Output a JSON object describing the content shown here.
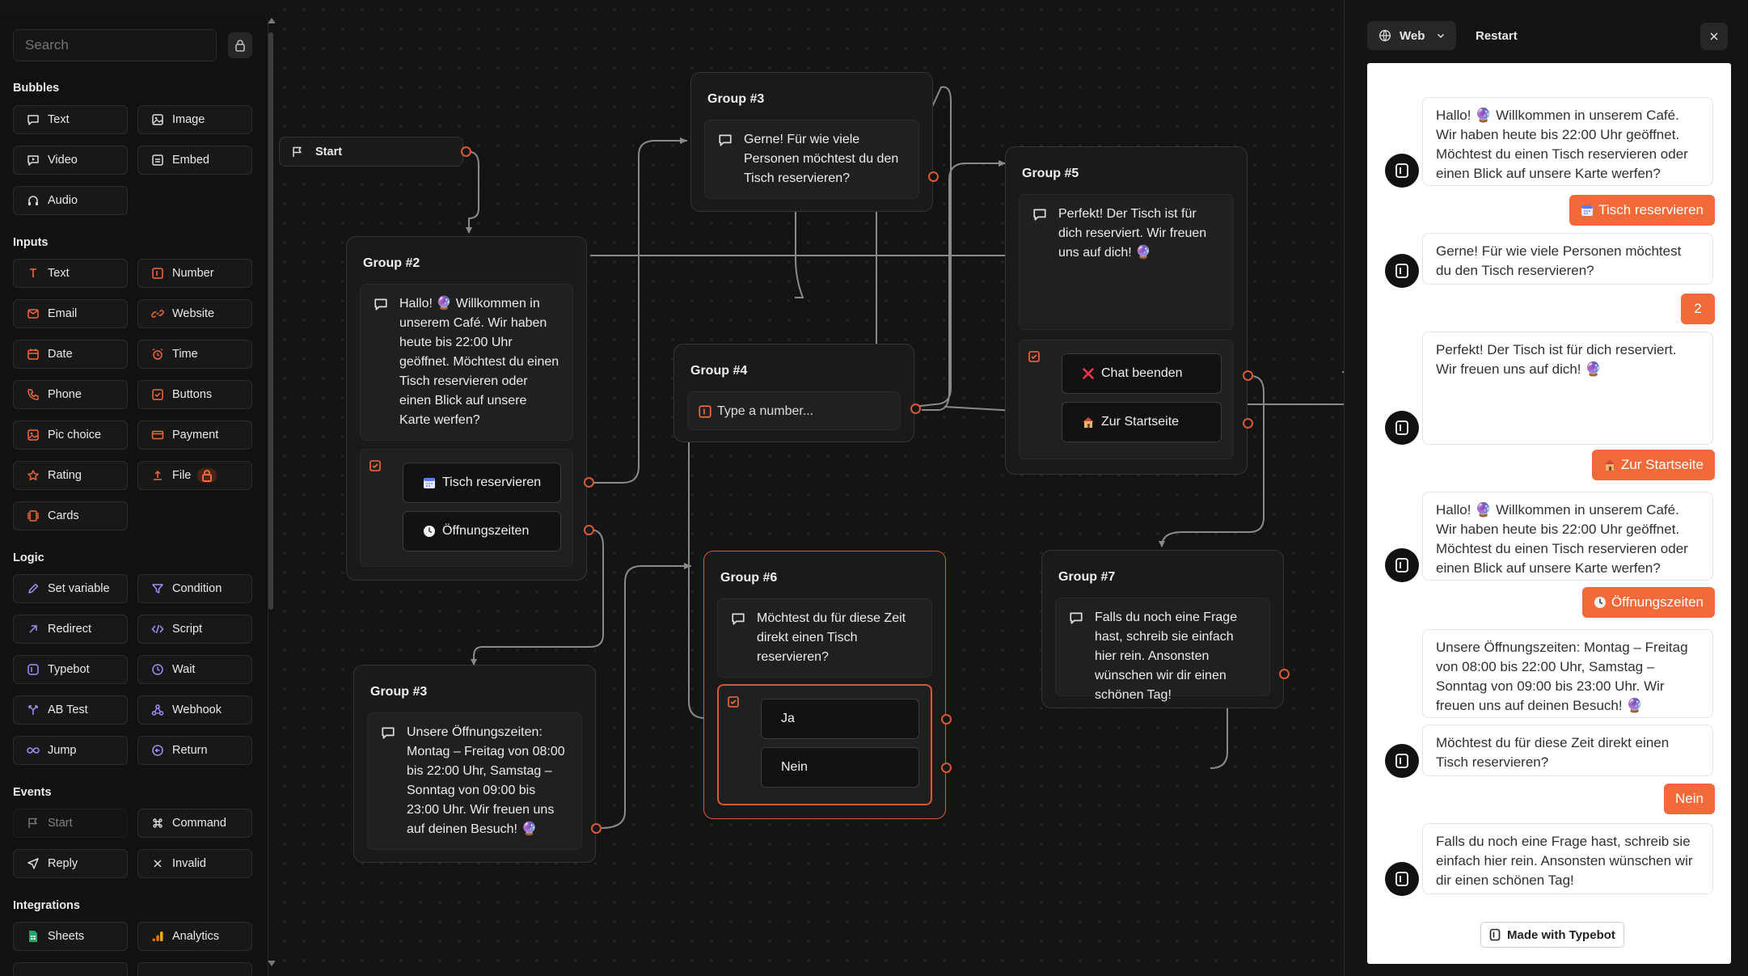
{
  "sidebar": {
    "search_placeholder": "Search",
    "sections": {
      "bubbles": "Bubbles",
      "inputs": "Inputs",
      "logic": "Logic",
      "events": "Events",
      "integrations": "Integrations"
    },
    "bubbles": [
      "Text",
      "Image",
      "Video",
      "Embed",
      "Audio"
    ],
    "inputs": [
      "Text",
      "Number",
      "Email",
      "Website",
      "Date",
      "Time",
      "Phone",
      "Buttons",
      "Pic choice",
      "Payment",
      "Rating",
      "File",
      "Cards"
    ],
    "logic": [
      "Set variable",
      "Condition",
      "Redirect",
      "Script",
      "Typebot",
      "Wait",
      "AB Test",
      "Webhook",
      "Jump",
      "Return"
    ],
    "events": [
      "Start",
      "Command",
      "Reply",
      "Invalid"
    ],
    "integrations": [
      "Sheets",
      "Analytics"
    ]
  },
  "colors": {
    "accent": "#f26a3a",
    "handle": "#d85a34",
    "canvas_bg": "#141414"
  },
  "canvas": {
    "start_label": "Start",
    "group2": {
      "title": "Group #2",
      "text": "Hallo! 🔮 Willkommen in unserem Café. Wir haben heute bis 22:00 Uhr geöffnet. Möchtest du einen Tisch reservieren oder einen Blick auf unsere Karte werfen?",
      "opt1": "Tisch reservieren",
      "opt2": "Öffnungszeiten"
    },
    "group3a": {
      "title": "Group #3",
      "text": "Gerne! Für wie viele Personen möchtest du den Tisch reservieren?"
    },
    "group3b": {
      "title": "Group #3",
      "text": "Unsere Öffnungszeiten: Montag – Freitag von 08:00 bis 22:00 Uhr, Samstag – Sonntag von 09:00 bis 23:00 Uhr. Wir freuen uns auf deinen Besuch! 🔮"
    },
    "group4": {
      "title": "Group #4",
      "placeholder": "Type a number..."
    },
    "group5": {
      "title": "Group #5",
      "text": "Perfekt! Der Tisch ist für dich reserviert. Wir freuen uns auf dich! 🔮",
      "opt1": "Chat beenden",
      "opt2": "Zur Startseite"
    },
    "group6": {
      "title": "Group #6",
      "text": "Möchtest du für diese Zeit direkt einen Tisch reservieren?",
      "opt1": "Ja",
      "opt2": "Nein"
    },
    "group7": {
      "title": "Group #7",
      "text": "Falls du noch eine Frage hast, schreib sie einfach hier rein. Ansonsten wünschen wir dir einen schönen Tag!"
    }
  },
  "preview": {
    "web_label": "Web",
    "restart_label": "Restart",
    "messages": [
      {
        "from": "bot",
        "text": "Hallo! 🔮 Willkommen in unserem Café. Wir haben heute bis 22:00 Uhr geöffnet. Möchtest du einen Tisch reservieren oder einen Blick auf unsere Karte werfen?"
      },
      {
        "from": "user",
        "text": "Tisch reservieren"
      },
      {
        "from": "bot",
        "text": "Gerne! Für wie viele Personen möchtest du den Tisch reservieren?"
      },
      {
        "from": "user",
        "text": "2"
      },
      {
        "from": "bot",
        "text": "Perfekt! Der Tisch ist für dich reserviert. Wir freuen uns auf dich! 🔮"
      },
      {
        "from": "user",
        "text": "Zur Startseite"
      },
      {
        "from": "bot",
        "text": "Hallo! 🔮 Willkommen in unserem Café. Wir haben heute bis 22:00 Uhr geöffnet. Möchtest du einen Tisch reservieren oder einen Blick auf unsere Karte werfen?"
      },
      {
        "from": "user",
        "text": "Öffnungszeiten"
      },
      {
        "from": "bot",
        "text": "Unsere Öffnungszeiten: Montag – Freitag von 08:00 bis 22:00 Uhr, Samstag – Sonntag von 09:00 bis 23:00 Uhr. Wir freuen uns auf deinen Besuch! 🔮"
      },
      {
        "from": "bot",
        "text": "Möchtest du für diese Zeit direkt einen Tisch reservieren?"
      },
      {
        "from": "user",
        "text": "Nein"
      },
      {
        "from": "bot",
        "text": "Falls du noch eine Frage hast, schreib sie einfach hier rein. Ansonsten wünschen wir dir einen schönen Tag!"
      }
    ],
    "made_with": "Made with Typebot"
  }
}
